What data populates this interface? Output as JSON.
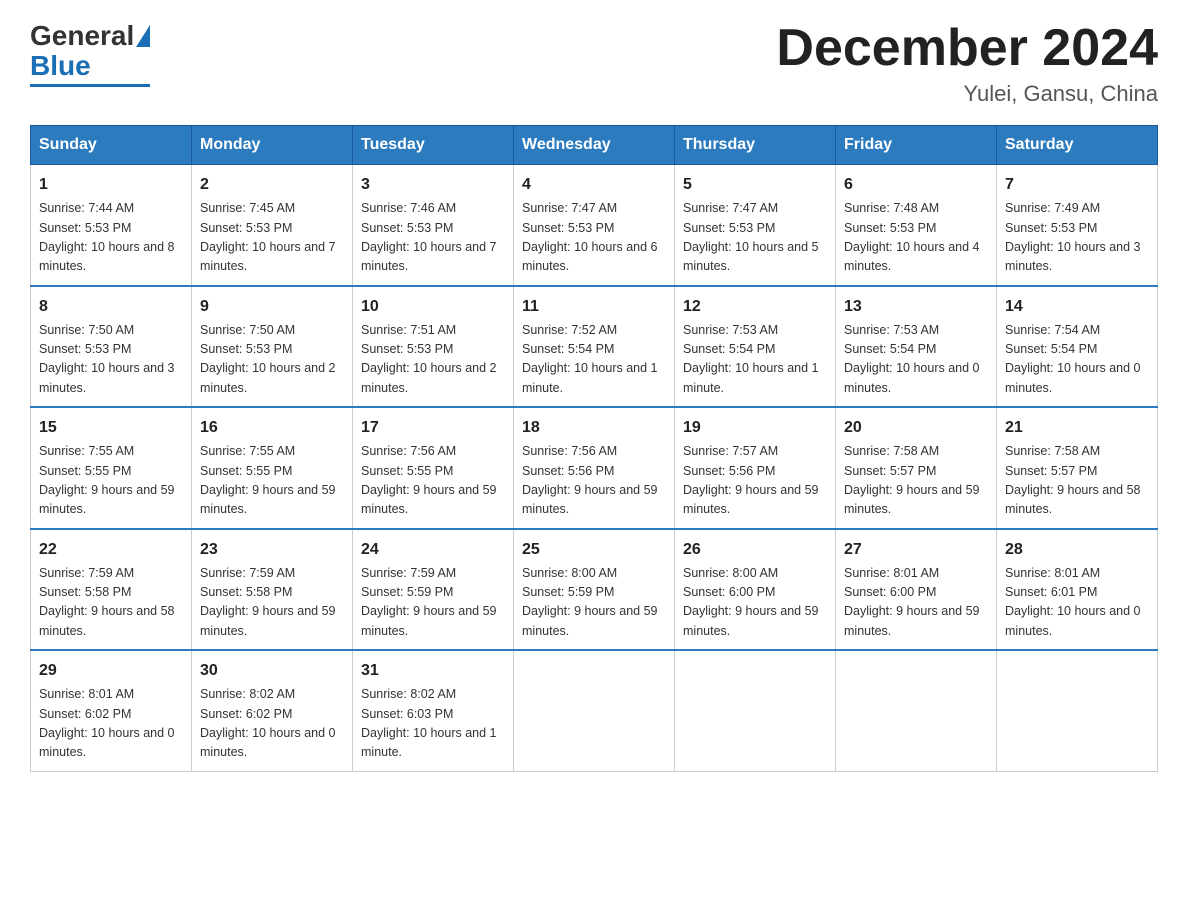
{
  "logo": {
    "general": "General",
    "blue": "Blue"
  },
  "title": "December 2024",
  "location": "Yulei, Gansu, China",
  "days_of_week": [
    "Sunday",
    "Monday",
    "Tuesday",
    "Wednesday",
    "Thursday",
    "Friday",
    "Saturday"
  ],
  "weeks": [
    [
      {
        "day": "1",
        "sunrise": "7:44 AM",
        "sunset": "5:53 PM",
        "daylight": "10 hours and 8 minutes."
      },
      {
        "day": "2",
        "sunrise": "7:45 AM",
        "sunset": "5:53 PM",
        "daylight": "10 hours and 7 minutes."
      },
      {
        "day": "3",
        "sunrise": "7:46 AM",
        "sunset": "5:53 PM",
        "daylight": "10 hours and 7 minutes."
      },
      {
        "day": "4",
        "sunrise": "7:47 AM",
        "sunset": "5:53 PM",
        "daylight": "10 hours and 6 minutes."
      },
      {
        "day": "5",
        "sunrise": "7:47 AM",
        "sunset": "5:53 PM",
        "daylight": "10 hours and 5 minutes."
      },
      {
        "day": "6",
        "sunrise": "7:48 AM",
        "sunset": "5:53 PM",
        "daylight": "10 hours and 4 minutes."
      },
      {
        "day": "7",
        "sunrise": "7:49 AM",
        "sunset": "5:53 PM",
        "daylight": "10 hours and 3 minutes."
      }
    ],
    [
      {
        "day": "8",
        "sunrise": "7:50 AM",
        "sunset": "5:53 PM",
        "daylight": "10 hours and 3 minutes."
      },
      {
        "day": "9",
        "sunrise": "7:50 AM",
        "sunset": "5:53 PM",
        "daylight": "10 hours and 2 minutes."
      },
      {
        "day": "10",
        "sunrise": "7:51 AM",
        "sunset": "5:53 PM",
        "daylight": "10 hours and 2 minutes."
      },
      {
        "day": "11",
        "sunrise": "7:52 AM",
        "sunset": "5:54 PM",
        "daylight": "10 hours and 1 minute."
      },
      {
        "day": "12",
        "sunrise": "7:53 AM",
        "sunset": "5:54 PM",
        "daylight": "10 hours and 1 minute."
      },
      {
        "day": "13",
        "sunrise": "7:53 AM",
        "sunset": "5:54 PM",
        "daylight": "10 hours and 0 minutes."
      },
      {
        "day": "14",
        "sunrise": "7:54 AM",
        "sunset": "5:54 PM",
        "daylight": "10 hours and 0 minutes."
      }
    ],
    [
      {
        "day": "15",
        "sunrise": "7:55 AM",
        "sunset": "5:55 PM",
        "daylight": "9 hours and 59 minutes."
      },
      {
        "day": "16",
        "sunrise": "7:55 AM",
        "sunset": "5:55 PM",
        "daylight": "9 hours and 59 minutes."
      },
      {
        "day": "17",
        "sunrise": "7:56 AM",
        "sunset": "5:55 PM",
        "daylight": "9 hours and 59 minutes."
      },
      {
        "day": "18",
        "sunrise": "7:56 AM",
        "sunset": "5:56 PM",
        "daylight": "9 hours and 59 minutes."
      },
      {
        "day": "19",
        "sunrise": "7:57 AM",
        "sunset": "5:56 PM",
        "daylight": "9 hours and 59 minutes."
      },
      {
        "day": "20",
        "sunrise": "7:58 AM",
        "sunset": "5:57 PM",
        "daylight": "9 hours and 59 minutes."
      },
      {
        "day": "21",
        "sunrise": "7:58 AM",
        "sunset": "5:57 PM",
        "daylight": "9 hours and 58 minutes."
      }
    ],
    [
      {
        "day": "22",
        "sunrise": "7:59 AM",
        "sunset": "5:58 PM",
        "daylight": "9 hours and 58 minutes."
      },
      {
        "day": "23",
        "sunrise": "7:59 AM",
        "sunset": "5:58 PM",
        "daylight": "9 hours and 59 minutes."
      },
      {
        "day": "24",
        "sunrise": "7:59 AM",
        "sunset": "5:59 PM",
        "daylight": "9 hours and 59 minutes."
      },
      {
        "day": "25",
        "sunrise": "8:00 AM",
        "sunset": "5:59 PM",
        "daylight": "9 hours and 59 minutes."
      },
      {
        "day": "26",
        "sunrise": "8:00 AM",
        "sunset": "6:00 PM",
        "daylight": "9 hours and 59 minutes."
      },
      {
        "day": "27",
        "sunrise": "8:01 AM",
        "sunset": "6:00 PM",
        "daylight": "9 hours and 59 minutes."
      },
      {
        "day": "28",
        "sunrise": "8:01 AM",
        "sunset": "6:01 PM",
        "daylight": "10 hours and 0 minutes."
      }
    ],
    [
      {
        "day": "29",
        "sunrise": "8:01 AM",
        "sunset": "6:02 PM",
        "daylight": "10 hours and 0 minutes."
      },
      {
        "day": "30",
        "sunrise": "8:02 AM",
        "sunset": "6:02 PM",
        "daylight": "10 hours and 0 minutes."
      },
      {
        "day": "31",
        "sunrise": "8:02 AM",
        "sunset": "6:03 PM",
        "daylight": "10 hours and 1 minute."
      },
      null,
      null,
      null,
      null
    ]
  ],
  "labels": {
    "sunrise": "Sunrise:",
    "sunset": "Sunset:",
    "daylight": "Daylight:"
  }
}
